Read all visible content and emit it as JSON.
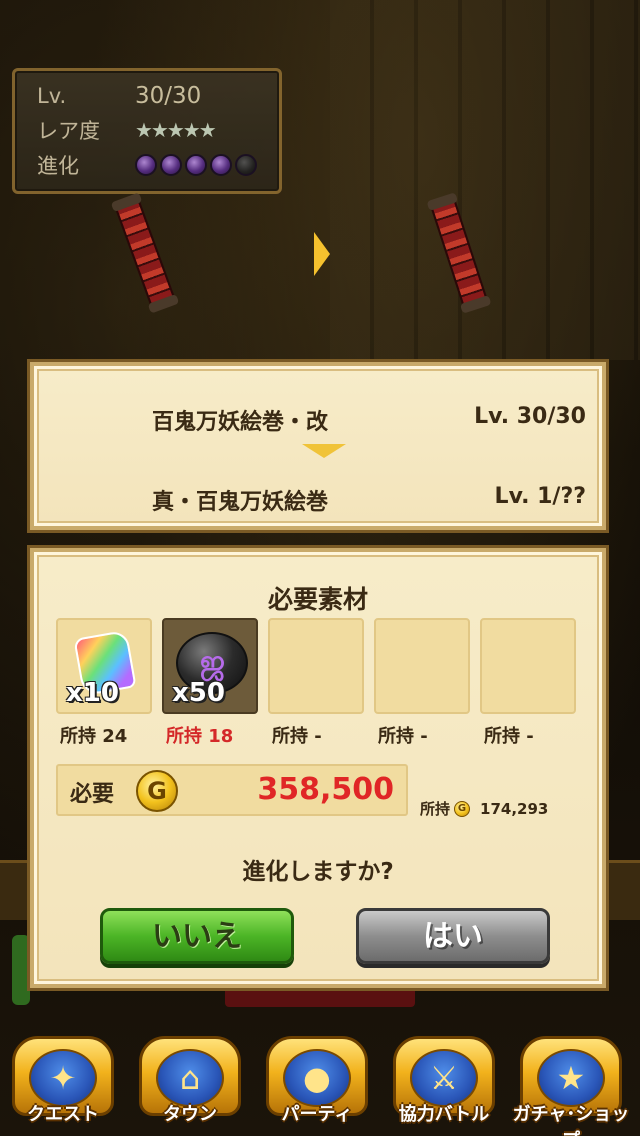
{
  "stats": {
    "level_label": "Lv.",
    "level_value": "30/30",
    "rarity_label": "レア度",
    "rarity_stars": "★★★★★",
    "evolution_label": "進化",
    "evolution_filled": 4,
    "evolution_total": 5
  },
  "evolution": {
    "from_name": "百鬼万妖絵巻・改",
    "from_level": "Lv. 30/30",
    "to_name": "真・百鬼万妖絵巻",
    "to_level": "Lv. 1/??"
  },
  "materials": {
    "title": "必要素材",
    "slots": [
      {
        "qty": "x10",
        "owned": "所持 24",
        "icon": "rainbow-gem-icon"
      },
      {
        "qty": "x50",
        "owned": "所持 18",
        "icon": "dark-orb-icon"
      },
      {
        "qty": "",
        "owned": "所持 -",
        "icon": ""
      },
      {
        "qty": "",
        "owned": "所持 -",
        "icon": ""
      },
      {
        "qty": "",
        "owned": "所持 -",
        "icon": ""
      }
    ],
    "cost_label": "必要",
    "coin_symbol": "G",
    "cost_value": "358,500",
    "owned_gold_label": "所持",
    "owned_gold_value": "174,293",
    "question": "進化しますか?",
    "no_label": "いいえ",
    "yes_label": "はい"
  },
  "nav": [
    {
      "label": "クエスト",
      "icon": "quest-map-icon"
    },
    {
      "label": "タウン",
      "icon": "town-icon"
    },
    {
      "label": "パーティ",
      "icon": "party-icon"
    },
    {
      "label": "協力バトル",
      "icon": "coop-battle-icon"
    },
    {
      "label": "ガチャ･ショップ",
      "icon": "gacha-star-icon"
    }
  ],
  "colors": {
    "cost_red": "#e02626",
    "owned_red": "#d42828",
    "button_green": "#4cb526",
    "button_gray": "#8e8e8e",
    "parchment": "#f3e4bb"
  }
}
